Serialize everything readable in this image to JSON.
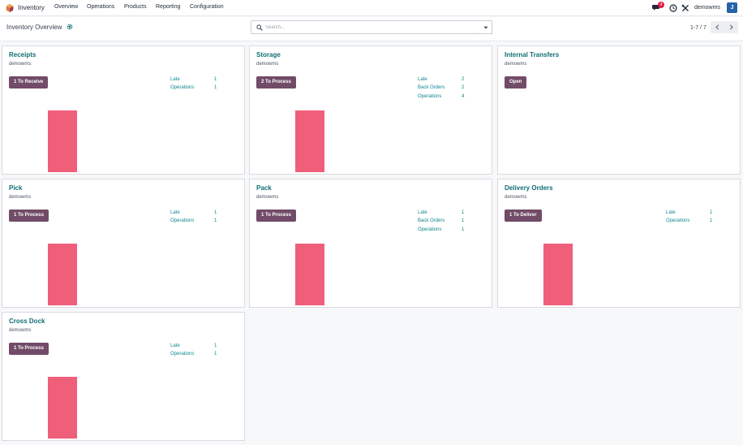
{
  "app": {
    "name": "Inventory",
    "menu": [
      "Overview",
      "Operations",
      "Products",
      "Reporting",
      "Configuration"
    ],
    "user": "demowms",
    "avatar_letter": "J",
    "message_count": "4"
  },
  "control": {
    "title": "Inventory Overview",
    "search_placeholder": "Search...",
    "pager": "1-7 / 7"
  },
  "cards": [
    {
      "title": "Receipts",
      "warehouse": "demowms",
      "button": "1 To Receive",
      "stats": [
        {
          "label": "Late",
          "value": "1"
        },
        {
          "label": "Operations",
          "value": "1"
        }
      ]
    },
    {
      "title": "Storage",
      "warehouse": "demowms",
      "button": "2 To Process",
      "stats": [
        {
          "label": "Late",
          "value": "2"
        },
        {
          "label": "Back Orders",
          "value": "2"
        },
        {
          "label": "Operations",
          "value": "4"
        }
      ]
    },
    {
      "title": "Internal Transfers",
      "warehouse": "demowms",
      "button": "Open",
      "stats": []
    },
    {
      "title": "Pick",
      "warehouse": "demowms",
      "button": "1 To Process",
      "stats": [
        {
          "label": "Late",
          "value": "1"
        },
        {
          "label": "Operations",
          "value": "1"
        }
      ]
    },
    {
      "title": "Pack",
      "warehouse": "demowms",
      "button": "1 To Process",
      "stats": [
        {
          "label": "Late",
          "value": "1"
        },
        {
          "label": "Back Orders",
          "value": "1"
        },
        {
          "label": "Operations",
          "value": "1"
        }
      ]
    },
    {
      "title": "Delivery Orders",
      "warehouse": "demowms",
      "button": "1 To Deliver",
      "stats": [
        {
          "label": "Late",
          "value": "1"
        },
        {
          "label": "Operations",
          "value": "1"
        }
      ]
    },
    {
      "title": "Cross Dock",
      "warehouse": "demowms",
      "button": "1 To Process",
      "stats": [
        {
          "label": "Late",
          "value": "1"
        },
        {
          "label": "Operations",
          "value": "1"
        }
      ]
    }
  ],
  "colors": {
    "accent": "#714b67",
    "title": "#0f6e74",
    "bar": "#ef5f7a",
    "link": "#0f8790"
  }
}
